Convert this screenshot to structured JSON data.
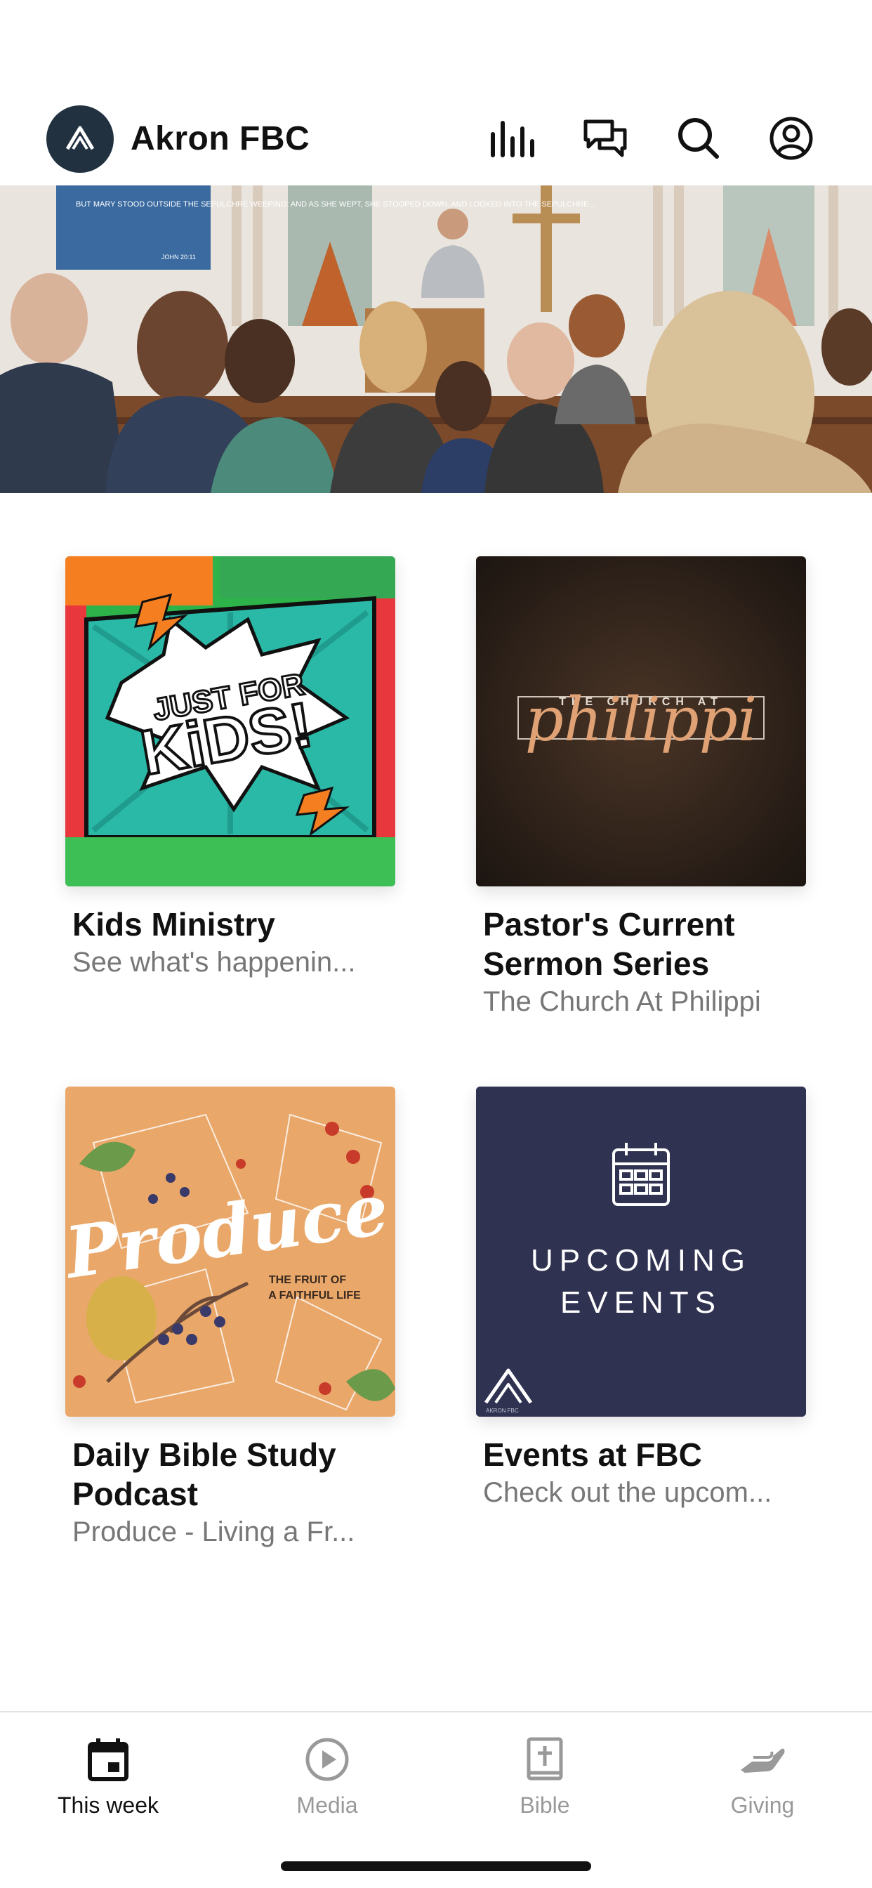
{
  "header": {
    "title": "Akron FBC",
    "icons": [
      "equalizer-icon",
      "chat-icon",
      "search-icon",
      "profile-icon"
    ]
  },
  "hero": {
    "screen_text": "BUT MARY STOOD OUTSIDE THE SEPULCHRE WEEPING: AND AS SHE WEPT, SHE STOOPED DOWN, AND LOOKED INTO THE SEPULCHRE...",
    "screen_ref": "JOHN 20:11"
  },
  "cards": [
    {
      "title": "Kids Ministry",
      "subtitle": "See what's happenin...",
      "art_line1": "JUST FOR",
      "art_line2": "KiDS!"
    },
    {
      "title": "Pastor's Current Sermon Series",
      "subtitle": "The Church At Philippi",
      "art_top": "THE CHURCH AT",
      "art_main": "philippi"
    },
    {
      "title": "Daily Bible Study Podcast",
      "subtitle": "Produce - Living a Fr...",
      "art_main": "Produce",
      "art_tag1": "THE FRUIT OF",
      "art_tag2": "A FAITHFUL LIFE"
    },
    {
      "title": "Events at FBC",
      "subtitle": "Check out the upcom...",
      "art_line1": "UPCOMING",
      "art_line2": "EVENTS",
      "art_brand": "AKRON FBC"
    }
  ],
  "tabs": [
    {
      "label": "This week",
      "icon": "calendar-icon",
      "active": true
    },
    {
      "label": "Media",
      "icon": "play-icon",
      "active": false
    },
    {
      "label": "Bible",
      "icon": "bible-icon",
      "active": false
    },
    {
      "label": "Giving",
      "icon": "giving-icon",
      "active": false
    }
  ],
  "colors": {
    "logo_bg": "#223140",
    "events_bg": "#2f3250",
    "inactive_tab": "#999999",
    "active_tab": "#111111"
  }
}
